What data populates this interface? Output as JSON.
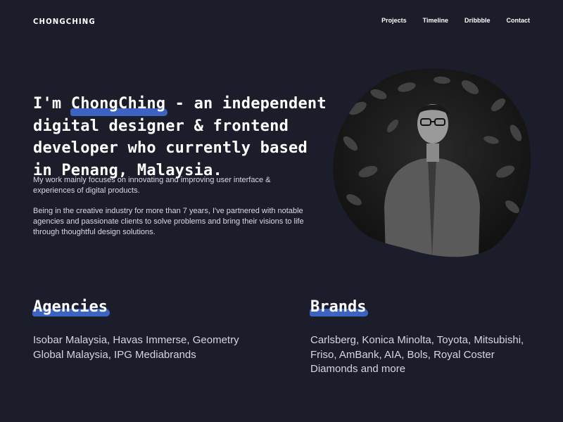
{
  "header": {
    "logo": "CHONGCHING",
    "nav": [
      "Projects",
      "Timeline",
      "Dribbble",
      "Contact"
    ]
  },
  "hero": {
    "headline_prefix": "I'm ",
    "headline_name": "ChongChing",
    "headline_suffix": " - an independent digital designer & frontend developer who currently based in Penang, Malaysia.",
    "paragraph_1": "My work mainly focuses on innovating and improving user interface & experiences of digital products.",
    "paragraph_2": "Being in the creative industry for more than 7 years, I've partnered with notable agencies and passionate clients to solve problems and bring their visions to life through thoughtful design solutions."
  },
  "agencies": {
    "title": "Agencies",
    "text": "Isobar Malaysia, Havas Immerse, Geometry Global Malaysia, IPG Mediabrands"
  },
  "brands": {
    "title": "Brands",
    "text": "Carlsberg, Konica Minolta, Toyota, Mitsubishi, Friso, AmBank, AIA, Bols, Royal Coster Diamonds and more"
  },
  "colors": {
    "background": "#1b1d2b",
    "accent": "#3d63c2",
    "text": "#ffffff"
  }
}
